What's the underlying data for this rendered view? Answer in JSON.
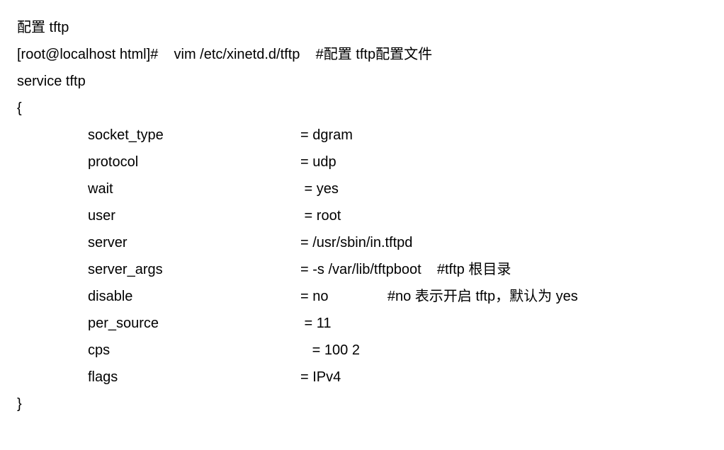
{
  "title": "配置 tftp",
  "prompt": "[root@localhost html]#",
  "command": "vim /etc/xinetd.d/tftp",
  "command_comment": "#配置 tftp配置文件",
  "service_line": "service tftp",
  "open_brace": "{",
  "close_brace": "}",
  "entries": [
    {
      "key": "socket_type",
      "val": "= dgram",
      "comment": ""
    },
    {
      "key": "protocol",
      "val": "= udp",
      "comment": ""
    },
    {
      "key": "wait",
      "val": " = yes",
      "comment": ""
    },
    {
      "key": "user",
      "val": " = root",
      "comment": ""
    },
    {
      "key": "server",
      "val": "= /usr/sbin/in.tftpd",
      "comment": ""
    },
    {
      "key": "server_args",
      "val": "= -s /var/lib/tftpboot",
      "comment": "    #tftp 根目录"
    },
    {
      "key": "disable",
      "val": "= no",
      "comment": "               #no 表示开启 tftp，默认为 yes"
    },
    {
      "key": "per_source",
      "val": " = 11",
      "comment": ""
    },
    {
      "key": "cps",
      "val": "   = 100 2",
      "comment": ""
    },
    {
      "key": "flags",
      "val": "= IPv4",
      "comment": ""
    }
  ]
}
